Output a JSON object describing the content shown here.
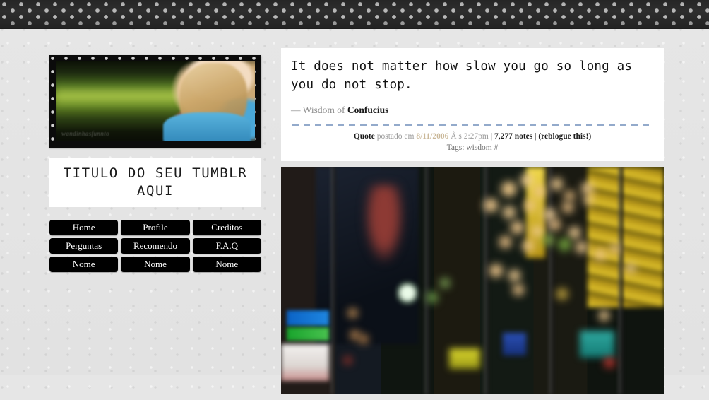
{
  "site": {
    "title": "TITULO DO SEU TUMBLR AQUI",
    "avatar_watermark": "wandinhasfunnto"
  },
  "nav": {
    "rows": [
      [
        {
          "label": "Home",
          "name": "nav-home"
        },
        {
          "label": "Profile",
          "name": "nav-profile"
        },
        {
          "label": "Creditos",
          "name": "nav-creditos"
        }
      ],
      [
        {
          "label": "Perguntas",
          "name": "nav-perguntas"
        },
        {
          "label": "Recomendo",
          "name": "nav-recomendo"
        },
        {
          "label": "F.A.Q",
          "name": "nav-faq"
        }
      ],
      [
        {
          "label": "Nome",
          "name": "nav-nome-1"
        },
        {
          "label": "Nome",
          "name": "nav-nome-2"
        },
        {
          "label": "Nome",
          "name": "nav-nome-3"
        }
      ]
    ]
  },
  "quote_post": {
    "text": "It does not matter how slow you go so long as you do not stop.",
    "source_prefix": "— Wisdom of",
    "source_author": "Confucius",
    "meta": {
      "post_type": "Quote",
      "posted_label": "postado em",
      "date": "8/11/2006",
      "time_prefix": "Å s",
      "time": "2:27pm",
      "separator": "|",
      "notes": "7,277 notes",
      "reblog": "(reblogue this!)",
      "tags_label": "Tags:",
      "tags": "wisdom #"
    }
  },
  "photo_post": {
    "alt": "blurred night city bokeh lights"
  },
  "colors": {
    "accent_link": "#cbb99a",
    "dashed_rule": "#93aacb",
    "button_bg": "#000000",
    "button_text": "#ffffff",
    "page_bg": "#e4e4e4",
    "header_band": "#2e2e2e"
  }
}
